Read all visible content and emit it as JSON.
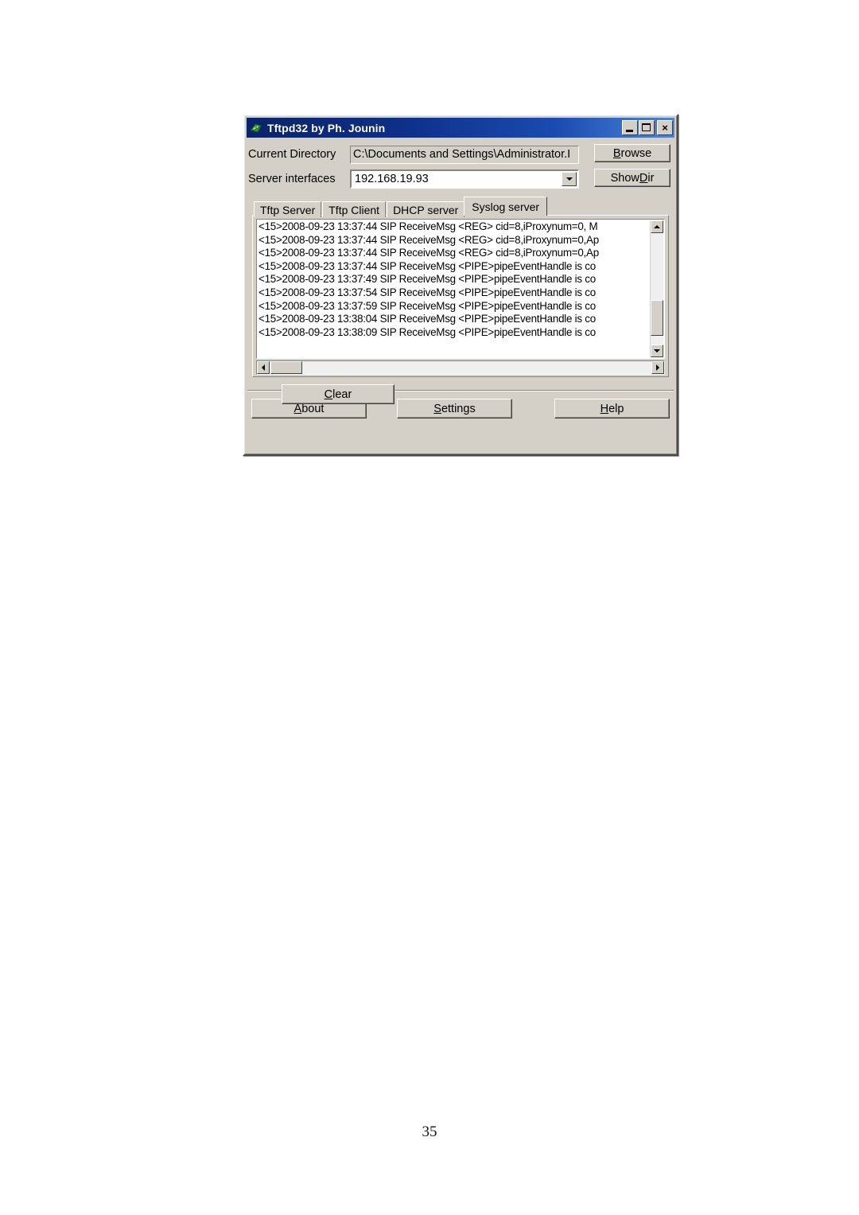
{
  "page": {
    "number": "35"
  },
  "window": {
    "title": "Tftpd32 by Ph. Jounin",
    "icon": "tftpd32-app-icon",
    "caption_buttons": {
      "minimize": "minimize-icon",
      "maximize": "maximize-icon",
      "close": "×"
    }
  },
  "form": {
    "directory": {
      "label": "Current Directory",
      "value": "C:\\Documents and Settings\\Administrator.I"
    },
    "interfaces": {
      "label": "Server interfaces",
      "value": "192.168.19.93",
      "dropdown_icon": "chevron-down-icon"
    },
    "browse_button": {
      "accel": "B",
      "rest": "rowse"
    },
    "showdir_button": {
      "pre": "Show ",
      "accel": "D",
      "rest": "ir"
    }
  },
  "tabs": [
    {
      "label": "Tftp Server",
      "active": false
    },
    {
      "label": "Tftp Client",
      "active": false
    },
    {
      "label": "DHCP server",
      "active": false
    },
    {
      "label": "Syslog server",
      "active": true
    }
  ],
  "syslog": {
    "lines": [
      "<15>2008-09-23 13:37:44 SIP ReceiveMsg <REG> cid=8,iProxynum=0, M",
      "<15>2008-09-23 13:37:44 SIP ReceiveMsg <REG> cid=8,iProxynum=0,Ap",
      "<15>2008-09-23 13:37:44 SIP ReceiveMsg <REG> cid=8,iProxynum=0,Ap",
      "<15>2008-09-23 13:37:44 SIP ReceiveMsg <PIPE>pipeEventHandle is co",
      "<15>2008-09-23 13:37:49 SIP ReceiveMsg <PIPE>pipeEventHandle is co",
      "<15>2008-09-23 13:37:54 SIP ReceiveMsg <PIPE>pipeEventHandle is co",
      "<15>2008-09-23 13:37:59 SIP ReceiveMsg <PIPE>pipeEventHandle is co",
      "<15>2008-09-23 13:38:04 SIP ReceiveMsg <PIPE>pipeEventHandle is co",
      "<15>2008-09-23 13:38:09 SIP ReceiveMsg <PIPE>pipeEventHandle is co"
    ],
    "scrollbars": {
      "vertical_up": "scroll-up-icon",
      "vertical_down": "scroll-down-icon",
      "horizontal_left": "scroll-left-icon",
      "horizontal_right": "scroll-right-icon"
    }
  },
  "buttons": {
    "clear": {
      "accel": "C",
      "rest": "lear"
    },
    "about": {
      "accel": "A",
      "rest": "bout"
    },
    "settings": {
      "accel": "S",
      "rest": "ettings"
    },
    "help": {
      "accel": "H",
      "rest": "elp"
    }
  },
  "colors": {
    "window_face": "#d4d0c8",
    "titlebar_start": "#0a246a",
    "titlebar_end": "#4a86d8",
    "field_background": "#ffffff",
    "text": "#000000"
  }
}
